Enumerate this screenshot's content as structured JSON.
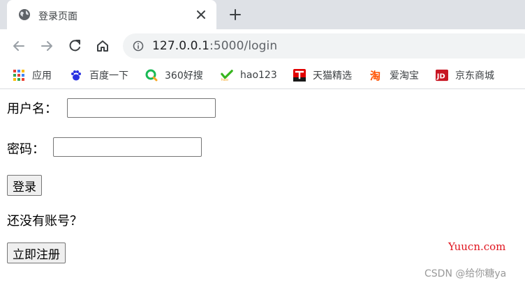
{
  "browser": {
    "tab": {
      "title": "登录页面",
      "icon": "globe-icon"
    },
    "url": {
      "host": "127.0.0.1",
      "rest": ":5000/login"
    },
    "bookmarks": [
      {
        "label": "应用",
        "icon": "apps-grid-icon"
      },
      {
        "label": "百度一下",
        "icon": "baidu-icon"
      },
      {
        "label": "360好搜",
        "icon": "360-search-icon"
      },
      {
        "label": "hao123",
        "icon": "hao123-icon"
      },
      {
        "label": "天猫精选",
        "icon": "tmall-icon"
      },
      {
        "label": "爱淘宝",
        "icon": "taobao-icon"
      },
      {
        "label": "京东商城",
        "icon": "jd-icon"
      }
    ]
  },
  "form": {
    "username_label": "用户名：",
    "username_value": "",
    "password_label": "密码：",
    "password_value": "",
    "login_button": "登录",
    "no_account_text": "还没有账号？",
    "register_button": "立即注册"
  },
  "overlay": {
    "watermark": "Yuucn.com",
    "credit": "CSDN @给你糖ya"
  },
  "colors": {
    "tabstrip": "#dee1e6",
    "omnibox": "#f1f3f4",
    "watermark": "#e0141e"
  }
}
